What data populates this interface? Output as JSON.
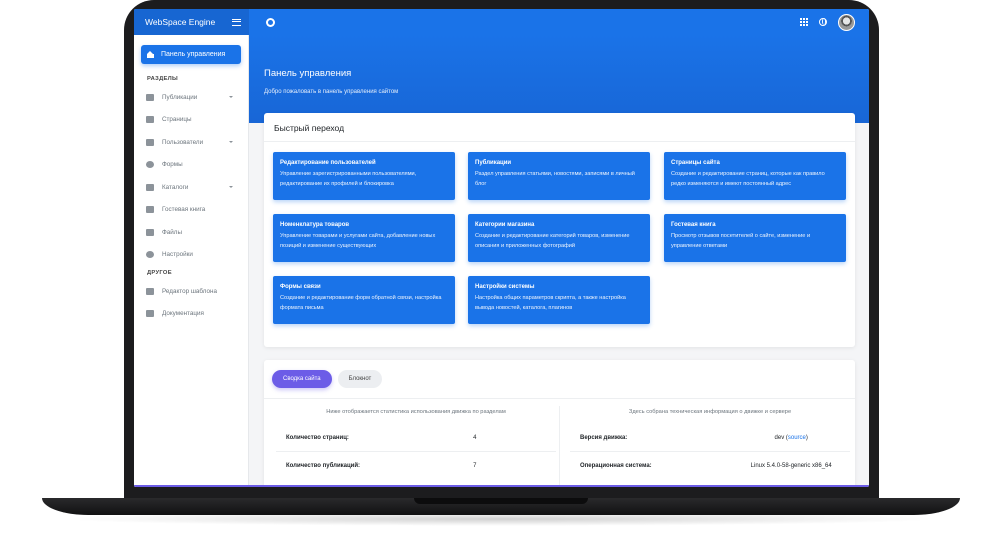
{
  "app": {
    "title": "WebSpace Engine"
  },
  "header": {
    "title": "Панель управления",
    "subtitle": "Добро пожаловать в панель управления сайтом"
  },
  "sidebar": {
    "active_item": "Панель управления",
    "sections": [
      {
        "label": "РАЗДЕЛЫ",
        "items": [
          {
            "label": "Публикации",
            "icon": "publications-icon",
            "has_caret": true
          },
          {
            "label": "Страницы",
            "icon": "pages-icon",
            "has_caret": false
          },
          {
            "label": "Пользователи",
            "icon": "users-icon",
            "has_caret": true
          },
          {
            "label": "Формы",
            "icon": "forms-icon",
            "has_caret": false
          },
          {
            "label": "Каталоги",
            "icon": "catalogs-icon",
            "has_caret": true
          },
          {
            "label": "Гостевая книга",
            "icon": "guestbook-icon",
            "has_caret": false
          },
          {
            "label": "Файлы",
            "icon": "files-icon",
            "has_caret": false
          },
          {
            "label": "Настройки",
            "icon": "settings-icon",
            "has_caret": false
          }
        ]
      },
      {
        "label": "ДРУГОЕ",
        "items": [
          {
            "label": "Редактор шаблона",
            "icon": "template-editor-icon",
            "has_caret": false
          },
          {
            "label": "Документация",
            "icon": "documentation-icon",
            "has_caret": false
          }
        ]
      }
    ]
  },
  "quick_access": {
    "title": "Быстрый переход",
    "tiles": [
      {
        "title": "Редактирование пользователей",
        "desc": "Управление зарегистрированными пользователями, редактирование их профилей и блокировка"
      },
      {
        "title": "Публикации",
        "desc": "Раздел управления статьями, новостями, записями в личный блог"
      },
      {
        "title": "Страницы сайта",
        "desc": "Создание и редактирование страниц, которые как правило редко изменяются и имеют постоянный адрес"
      },
      {
        "title": "Номенклатура товаров",
        "desc": "Управление товарами и услугами сайта, добавление новых позиций и изменение существующих"
      },
      {
        "title": "Категории магазина",
        "desc": "Создание и редактирование категорий товаров, изменение описания и приложенных фотографий"
      },
      {
        "title": "Гостевая книга",
        "desc": "Просмотр отзывов посетителей о сайте, изменение и управление ответами"
      },
      {
        "title": "Формы связи",
        "desc": "Создание и редактирование форм обратной связи, настройка формата письма"
      },
      {
        "title": "Настройки системы",
        "desc": "Настройка общих параметров скрипта, а также настройка вывода новостей, каталога, плагинов"
      }
    ]
  },
  "summary": {
    "tabs": [
      {
        "label": "Сводка сайта",
        "active": true
      },
      {
        "label": "Блокнот",
        "active": false
      }
    ],
    "left_caption": "Ниже отображается статистика использования движка по разделам",
    "right_caption": "Здесь собрана техническая информация о движке и сервере",
    "left_rows": [
      {
        "label": "Количество страниц:",
        "value": "4"
      },
      {
        "label": "Количество публикаций:",
        "value": "7"
      }
    ],
    "right_rows": [
      {
        "label": "Версия движка:",
        "value": "dev",
        "link": "source"
      },
      {
        "label": "Операционная система:",
        "value": "Linux 5.4.0-58-generic x86_64"
      }
    ]
  },
  "colors": {
    "primary": "#1a73e8",
    "accent": "#6c5ce7"
  }
}
